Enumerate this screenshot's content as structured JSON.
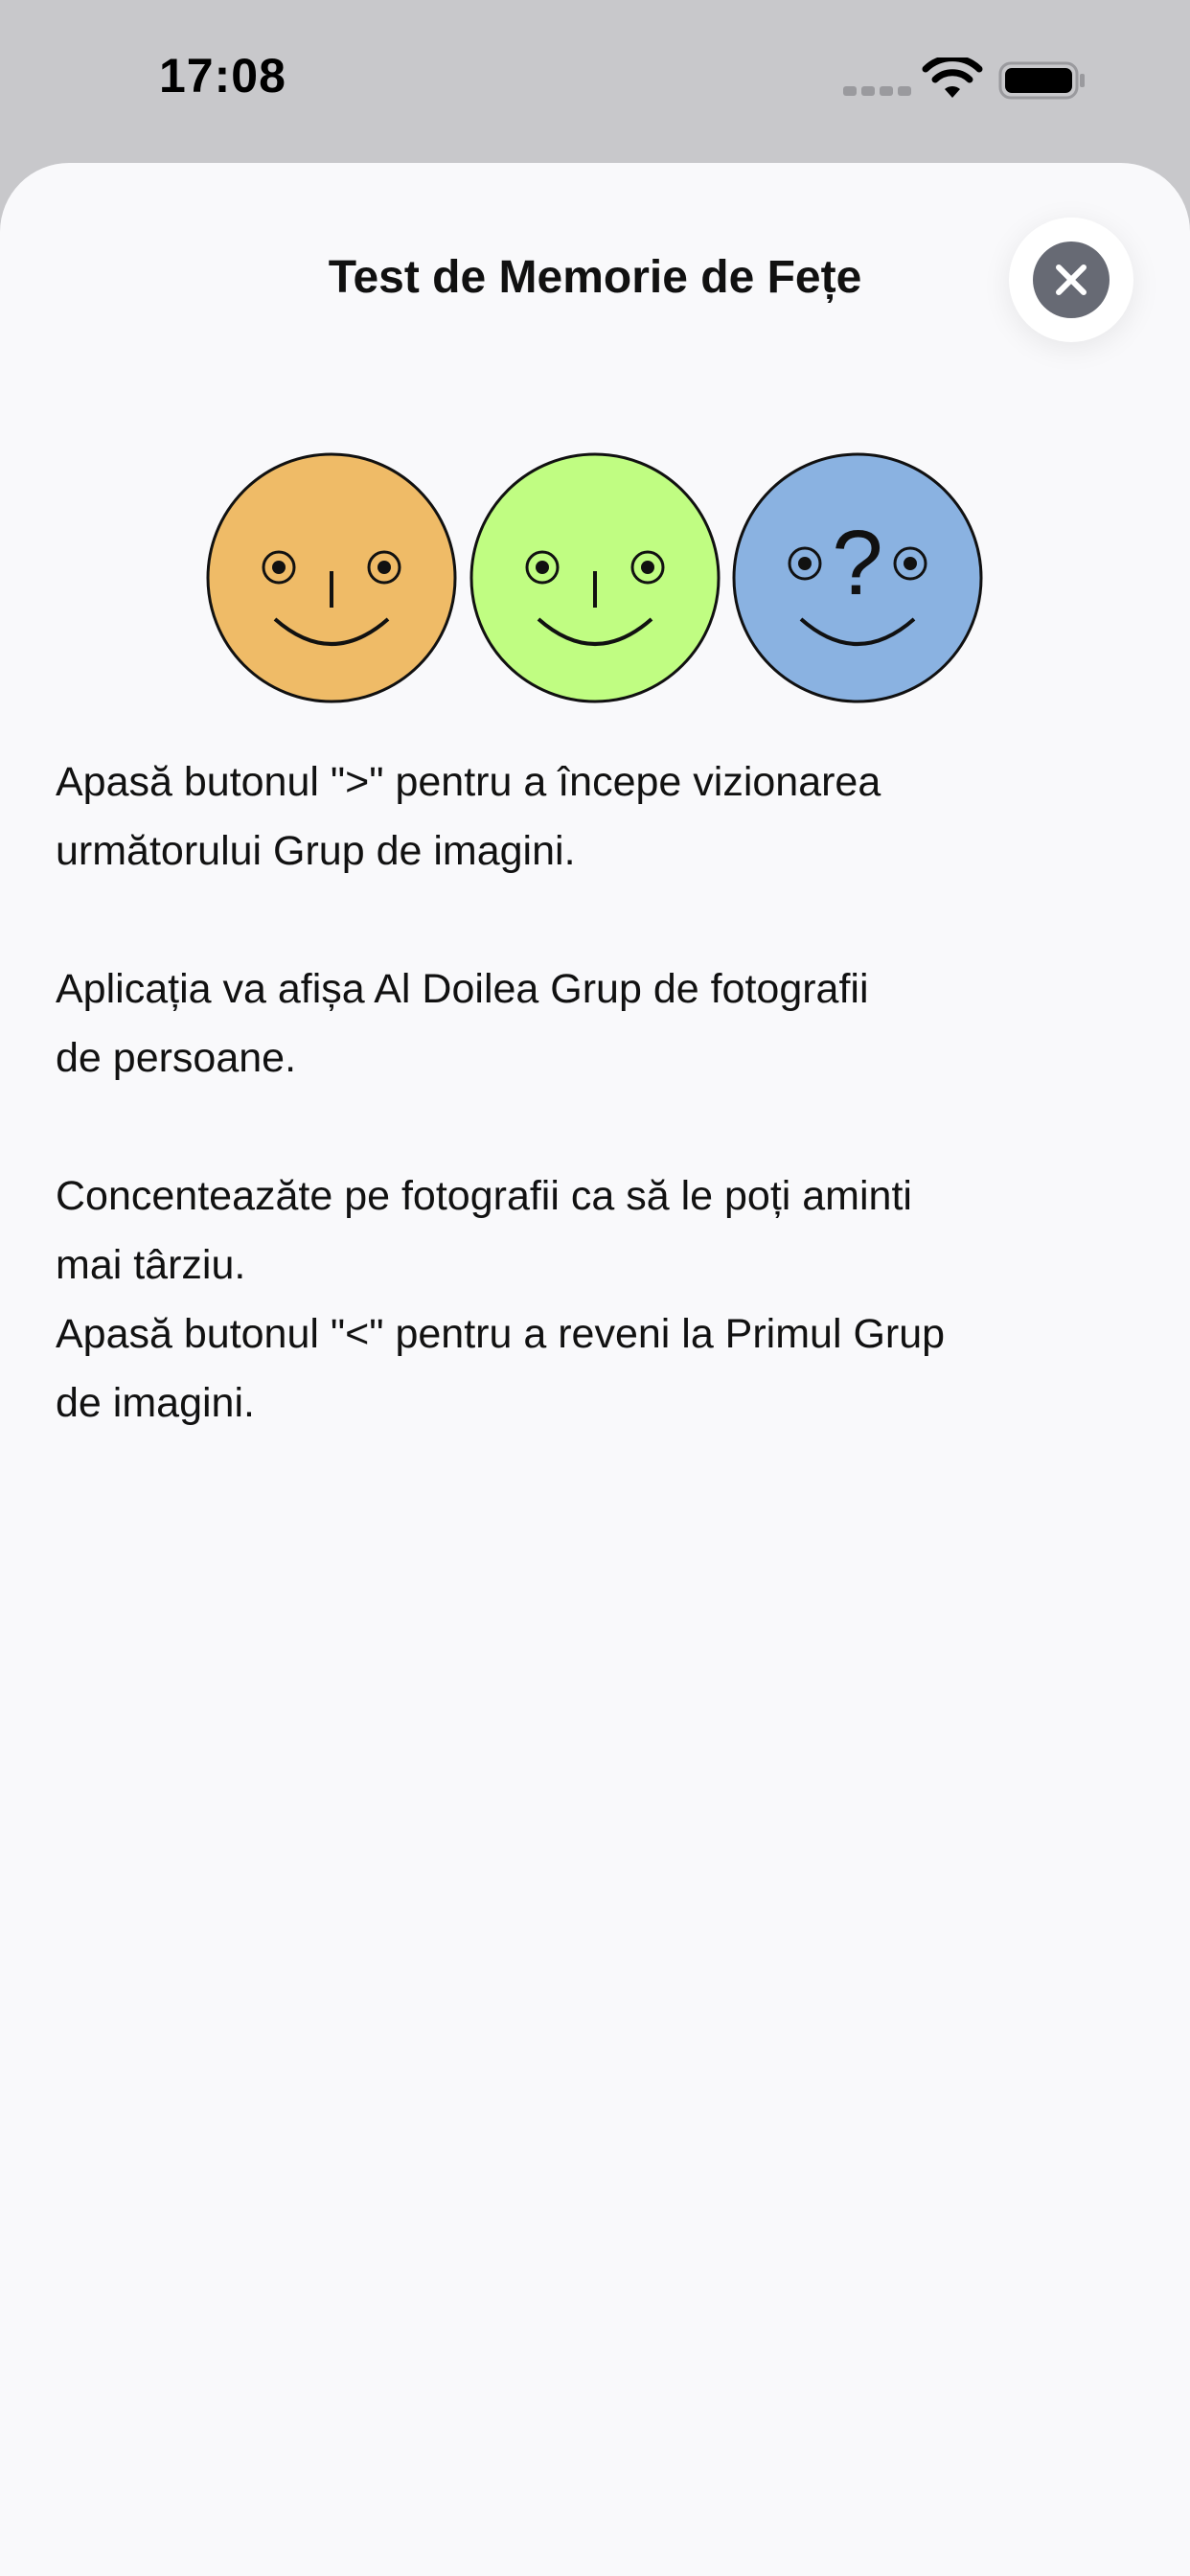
{
  "status_bar": {
    "time": "17:08",
    "icons": [
      "cellular-signal-icon",
      "wifi-icon",
      "battery-icon"
    ]
  },
  "sheet": {
    "title": "Test de Memorie de Fețe",
    "close_icon": "close-icon",
    "faces": [
      {
        "color": "#efbb67",
        "mark": "|"
      },
      {
        "color": "#c0fd82",
        "mark": "|"
      },
      {
        "color": "#8ab2e1",
        "mark": "?"
      }
    ],
    "instructions": "Apasă butonul \">\" pentru a începe vizionarea\nurmătorului Grup de imagini.\n\nAplicația va afișa Al Doilea Grup de fotografii\nde persoane.\n\nConcenteazăte pe fotografii ca să le poți aminti\nmai târziu.\nApasă butonul \"<\" pentru a reveni la Primul Grup\nde imagini."
  },
  "colors": {
    "sheet_background": "#f9f9fb",
    "status_background": "#c8c8cb",
    "close_button": "#676a74"
  }
}
